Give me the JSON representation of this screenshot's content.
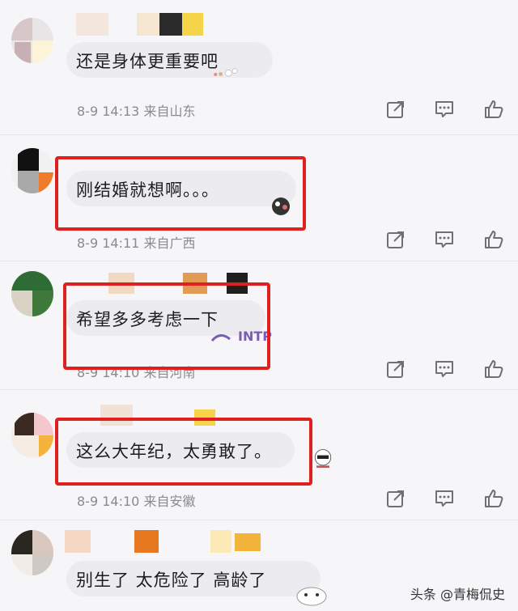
{
  "comments": [
    {
      "text": "还是身体更重要吧",
      "date": "8-9",
      "time": "14:13",
      "location": "来自山东"
    },
    {
      "text": "刚结婚就想啊。。。",
      "date": "8-9",
      "time": "14:11",
      "location": "来自广西"
    },
    {
      "text": "希望多多考虑一下",
      "date": "8-9",
      "time": "14:10",
      "location": "来自河南"
    },
    {
      "text": "这么大年纪，太勇敢了。",
      "date": "8-9",
      "time": "14:10",
      "location": "来自安徽"
    },
    {
      "text": "别生了 太危险了 高龄了"
    }
  ],
  "icons": {
    "share": "share-icon",
    "reply": "comment-icon",
    "like": "thumbs-up-icon"
  },
  "colors": {
    "highlight_box": "#e02020",
    "meta_text": "#8a8a8f",
    "icon": "#6f6f74"
  },
  "watermark": "头条 @青梅侃史"
}
